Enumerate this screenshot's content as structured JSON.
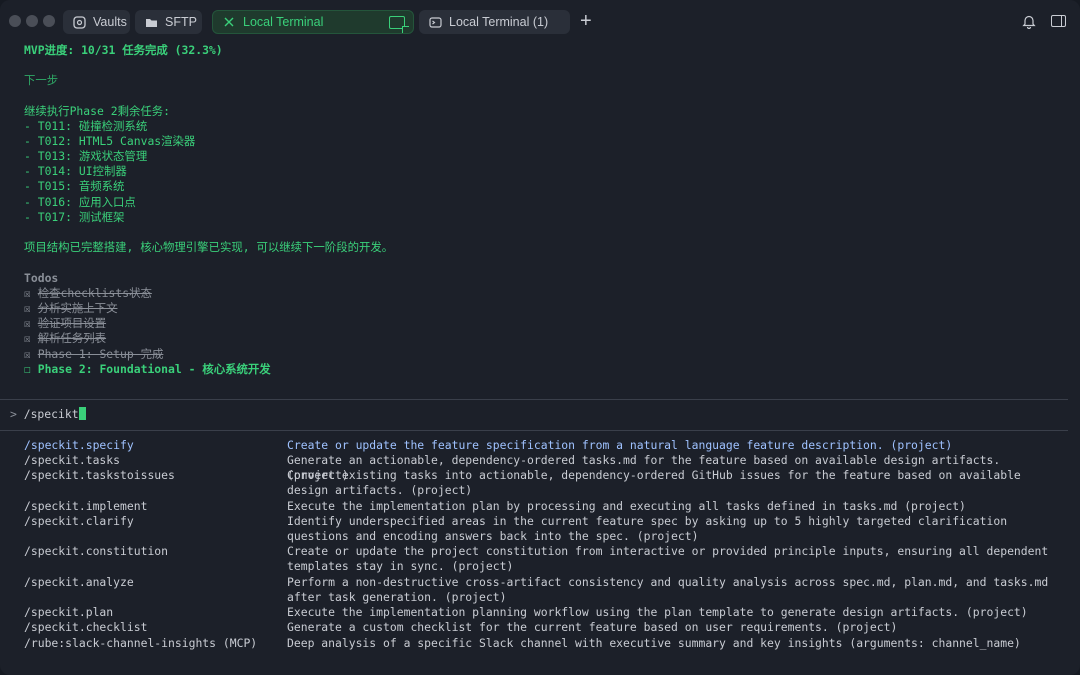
{
  "tabs": [
    {
      "label": "Vaults",
      "icon": "vault-icon"
    },
    {
      "label": "SFTP",
      "icon": "folder-icon"
    },
    {
      "label": "Local Terminal",
      "icon": "terminal-icon",
      "active": true
    },
    {
      "label": "Local Terminal (1)",
      "icon": "terminal-icon"
    }
  ],
  "terminal": {
    "mvp_progress": "MVP进度: 10/31 任务完成 (32.3%)",
    "next_step": "下一步",
    "continue_heading": "继续执行Phase 2剩余任务:",
    "tasks": [
      "- T011: 碰撞检测系统",
      "- T012: HTML5 Canvas渲染器",
      "- T013: 游戏状态管理",
      "- T014: UI控制器",
      "- T015: 音频系统",
      "- T016: 应用入口点",
      "- T017: 测试框架"
    ],
    "summary": "项目结构已完整搭建, 核心物理引擎已实现, 可以继续下一阶段的开发。",
    "todos_title": "Todos",
    "todos_done": [
      "检查checklists状态",
      "分析实施上下文",
      "验证项目设置",
      "解析任务列表",
      "Phase 1: Setup 完成"
    ],
    "todo_current": "Phase 2: Foundational - 核心系统开发",
    "checked_box": "☒",
    "open_box": "☐",
    "prompt_symbol": ">",
    "input_value": "/specikt"
  },
  "commands": [
    {
      "name": "/speckit.specify",
      "desc": "Create or update the feature specification from a natural language feature description. (project)",
      "selected": true
    },
    {
      "name": "/speckit.tasks",
      "desc": "Generate an actionable, dependency-ordered tasks.md for the feature based on available design artifacts. (project)"
    },
    {
      "name": "/speckit.taskstoissues",
      "desc": "Convert existing tasks into actionable, dependency-ordered GitHub issues for the feature based on available design artifacts. (project)"
    },
    {
      "name": "/speckit.implement",
      "desc": "Execute the implementation plan by processing and executing all tasks defined in tasks.md (project)"
    },
    {
      "name": "/speckit.clarify",
      "desc": "Identify underspecified areas in the current feature spec by asking up to 5 highly targeted clarification questions and encoding answers back into the spec. (project)"
    },
    {
      "name": "/speckit.constitution",
      "desc": "Create or update the project constitution from interactive or provided principle inputs, ensuring all dependent templates stay in sync. (project)"
    },
    {
      "name": "/speckit.analyze",
      "desc": "Perform a non-destructive cross-artifact consistency and quality analysis across spec.md, plan.md, and tasks.md after task generation. (project)"
    },
    {
      "name": "/speckit.plan",
      "desc": "Execute the implementation planning workflow using the plan template to generate design artifacts. (project)"
    },
    {
      "name": "/speckit.checklist",
      "desc": "Generate a custom checklist for the current feature based on user requirements. (project)"
    },
    {
      "name": "/rube:slack-channel-insights (MCP)",
      "desc": "Deep analysis of a specific Slack channel with executive summary and key insights (arguments: channel_name)"
    }
  ]
}
